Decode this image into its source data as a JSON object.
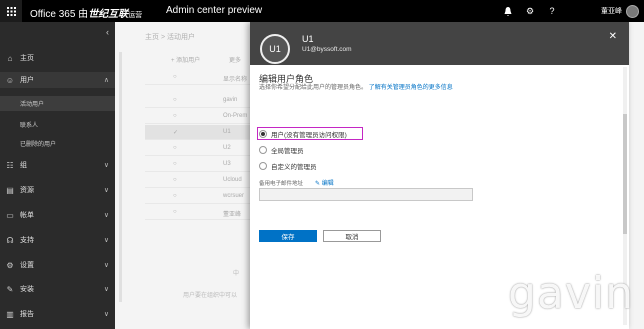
{
  "topbar": {
    "brand_prefix": "Office 365 由",
    "brand_bold": "世纪互联",
    "brand_suffix": "运营",
    "app_title": "Admin center preview",
    "bell_icon": "bell-icon",
    "gear_icon": "gear-icon",
    "help_icon": "help-icon",
    "user_name": "董亚峰"
  },
  "sidebar": {
    "collapse_icon": "chevron-left-icon",
    "items": [
      {
        "label": "主页",
        "icon": "home-icon"
      },
      {
        "label": "用户",
        "icon": "user-icon"
      },
      {
        "label": "组",
        "icon": "group-icon"
      },
      {
        "label": "资源",
        "icon": "resource-icon"
      },
      {
        "label": "帐单",
        "icon": "billing-icon"
      },
      {
        "label": "支持",
        "icon": "headset-icon"
      },
      {
        "label": "设置",
        "icon": "gear-icon"
      },
      {
        "label": "安装",
        "icon": "wrench-icon"
      },
      {
        "label": "报告",
        "icon": "chart-icon"
      }
    ],
    "subitems": [
      "活动用户",
      "联系人",
      "已删除的用户"
    ]
  },
  "background": {
    "breadcrumb": "主页 > 活动用户",
    "add_user": "+ 添加用户",
    "more": "更多",
    "col_header": "显示名称",
    "rows": [
      "gavin",
      "On-Prem",
      "U1",
      "U2",
      "U3",
      "Ucloud",
      "wcrsuer",
      "董亚峰"
    ],
    "footer_char": "中",
    "footer_text": "用户要在组织中可以"
  },
  "panel": {
    "avatar_initials": "U1",
    "name": "U1",
    "email": "U1@byssoft.com",
    "close_icon": "close-icon",
    "title": "编辑用户角色",
    "desc": "选择你希望分配给此用户的管理员角色。",
    "desc_link": "了解有关管理员角色的更多信息",
    "roles": [
      {
        "label": "用户(没有管理员访问权限)",
        "selected": true
      },
      {
        "label": "全局管理员",
        "selected": false
      },
      {
        "label": "自定义的管理员",
        "selected": false
      }
    ],
    "alt_email_label": "备用电子邮件地址",
    "edit_link": "编辑",
    "save": "保存",
    "cancel": "取消"
  },
  "watermark": "gavin",
  "colors": {
    "accent": "#0072c6",
    "highlight": "#c427c4",
    "topbar": "#000000",
    "panel_header": "#444444"
  }
}
